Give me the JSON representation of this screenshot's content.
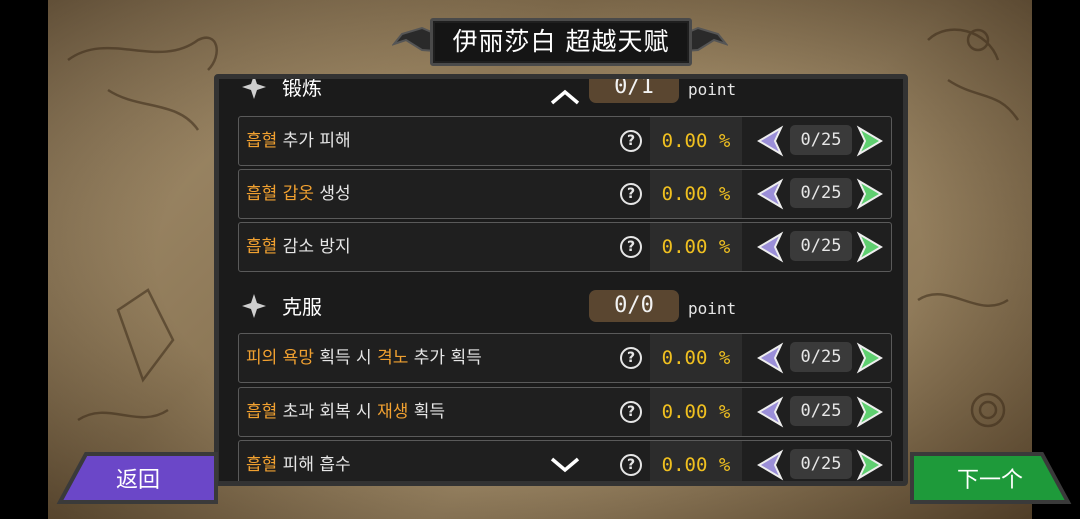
{
  "title": "伊丽莎白 超越天赋",
  "colors": {
    "highlight": "#f0a030",
    "value": "#f0c020",
    "back_button": "#6b47c8",
    "next_button": "#1e9a3a"
  },
  "top_section": {
    "title": "锻炼",
    "points": "0/1",
    "points_unit": "point"
  },
  "rows_top": [
    {
      "label_parts": [
        {
          "text": "흡혈",
          "hl": true
        },
        {
          "text": " 추가 피해",
          "hl": false
        }
      ],
      "value": "0.00 %",
      "count": "0/25"
    },
    {
      "label_parts": [
        {
          "text": "흡혈",
          "hl": true
        },
        {
          "text": " ",
          "hl": false
        },
        {
          "text": "갑옷",
          "hl": true
        },
        {
          "text": " 생성",
          "hl": false
        }
      ],
      "value": "0.00 %",
      "count": "0/25"
    },
    {
      "label_parts": [
        {
          "text": "흡혈",
          "hl": true
        },
        {
          "text": " 감소 방지",
          "hl": false
        }
      ],
      "value": "0.00 %",
      "count": "0/25"
    }
  ],
  "section_overcome": {
    "title": "克服",
    "points": "0/0",
    "points_unit": "point"
  },
  "rows_overcome": [
    {
      "label_parts": [
        {
          "text": "피의 욕망",
          "hl": true
        },
        {
          "text": " 획득 시 ",
          "hl": false
        },
        {
          "text": "격노",
          "hl": true
        },
        {
          "text": " 추가 획득",
          "hl": false
        }
      ],
      "value": "0.00 %",
      "count": "0/25"
    },
    {
      "label_parts": [
        {
          "text": "흡혈",
          "hl": true
        },
        {
          "text": " 초과 회복 시 ",
          "hl": false
        },
        {
          "text": "재생",
          "hl": true
        },
        {
          "text": " 획득",
          "hl": false
        }
      ],
      "value": "0.00 %",
      "count": "0/25"
    },
    {
      "label_parts": [
        {
          "text": "흡혈",
          "hl": true
        },
        {
          "text": " 피해 흡수",
          "hl": false
        }
      ],
      "value": "0.00 %",
      "count": "0/25"
    }
  ],
  "buttons": {
    "back": "返回",
    "next": "下一个"
  },
  "icons": {
    "help": "question-circle-icon",
    "decrease": "arrow-left-icon",
    "increase": "arrow-right-icon",
    "section": "four-point-star-icon",
    "scroll_up": "chevron-up-icon",
    "scroll_down": "chevron-down-icon"
  }
}
